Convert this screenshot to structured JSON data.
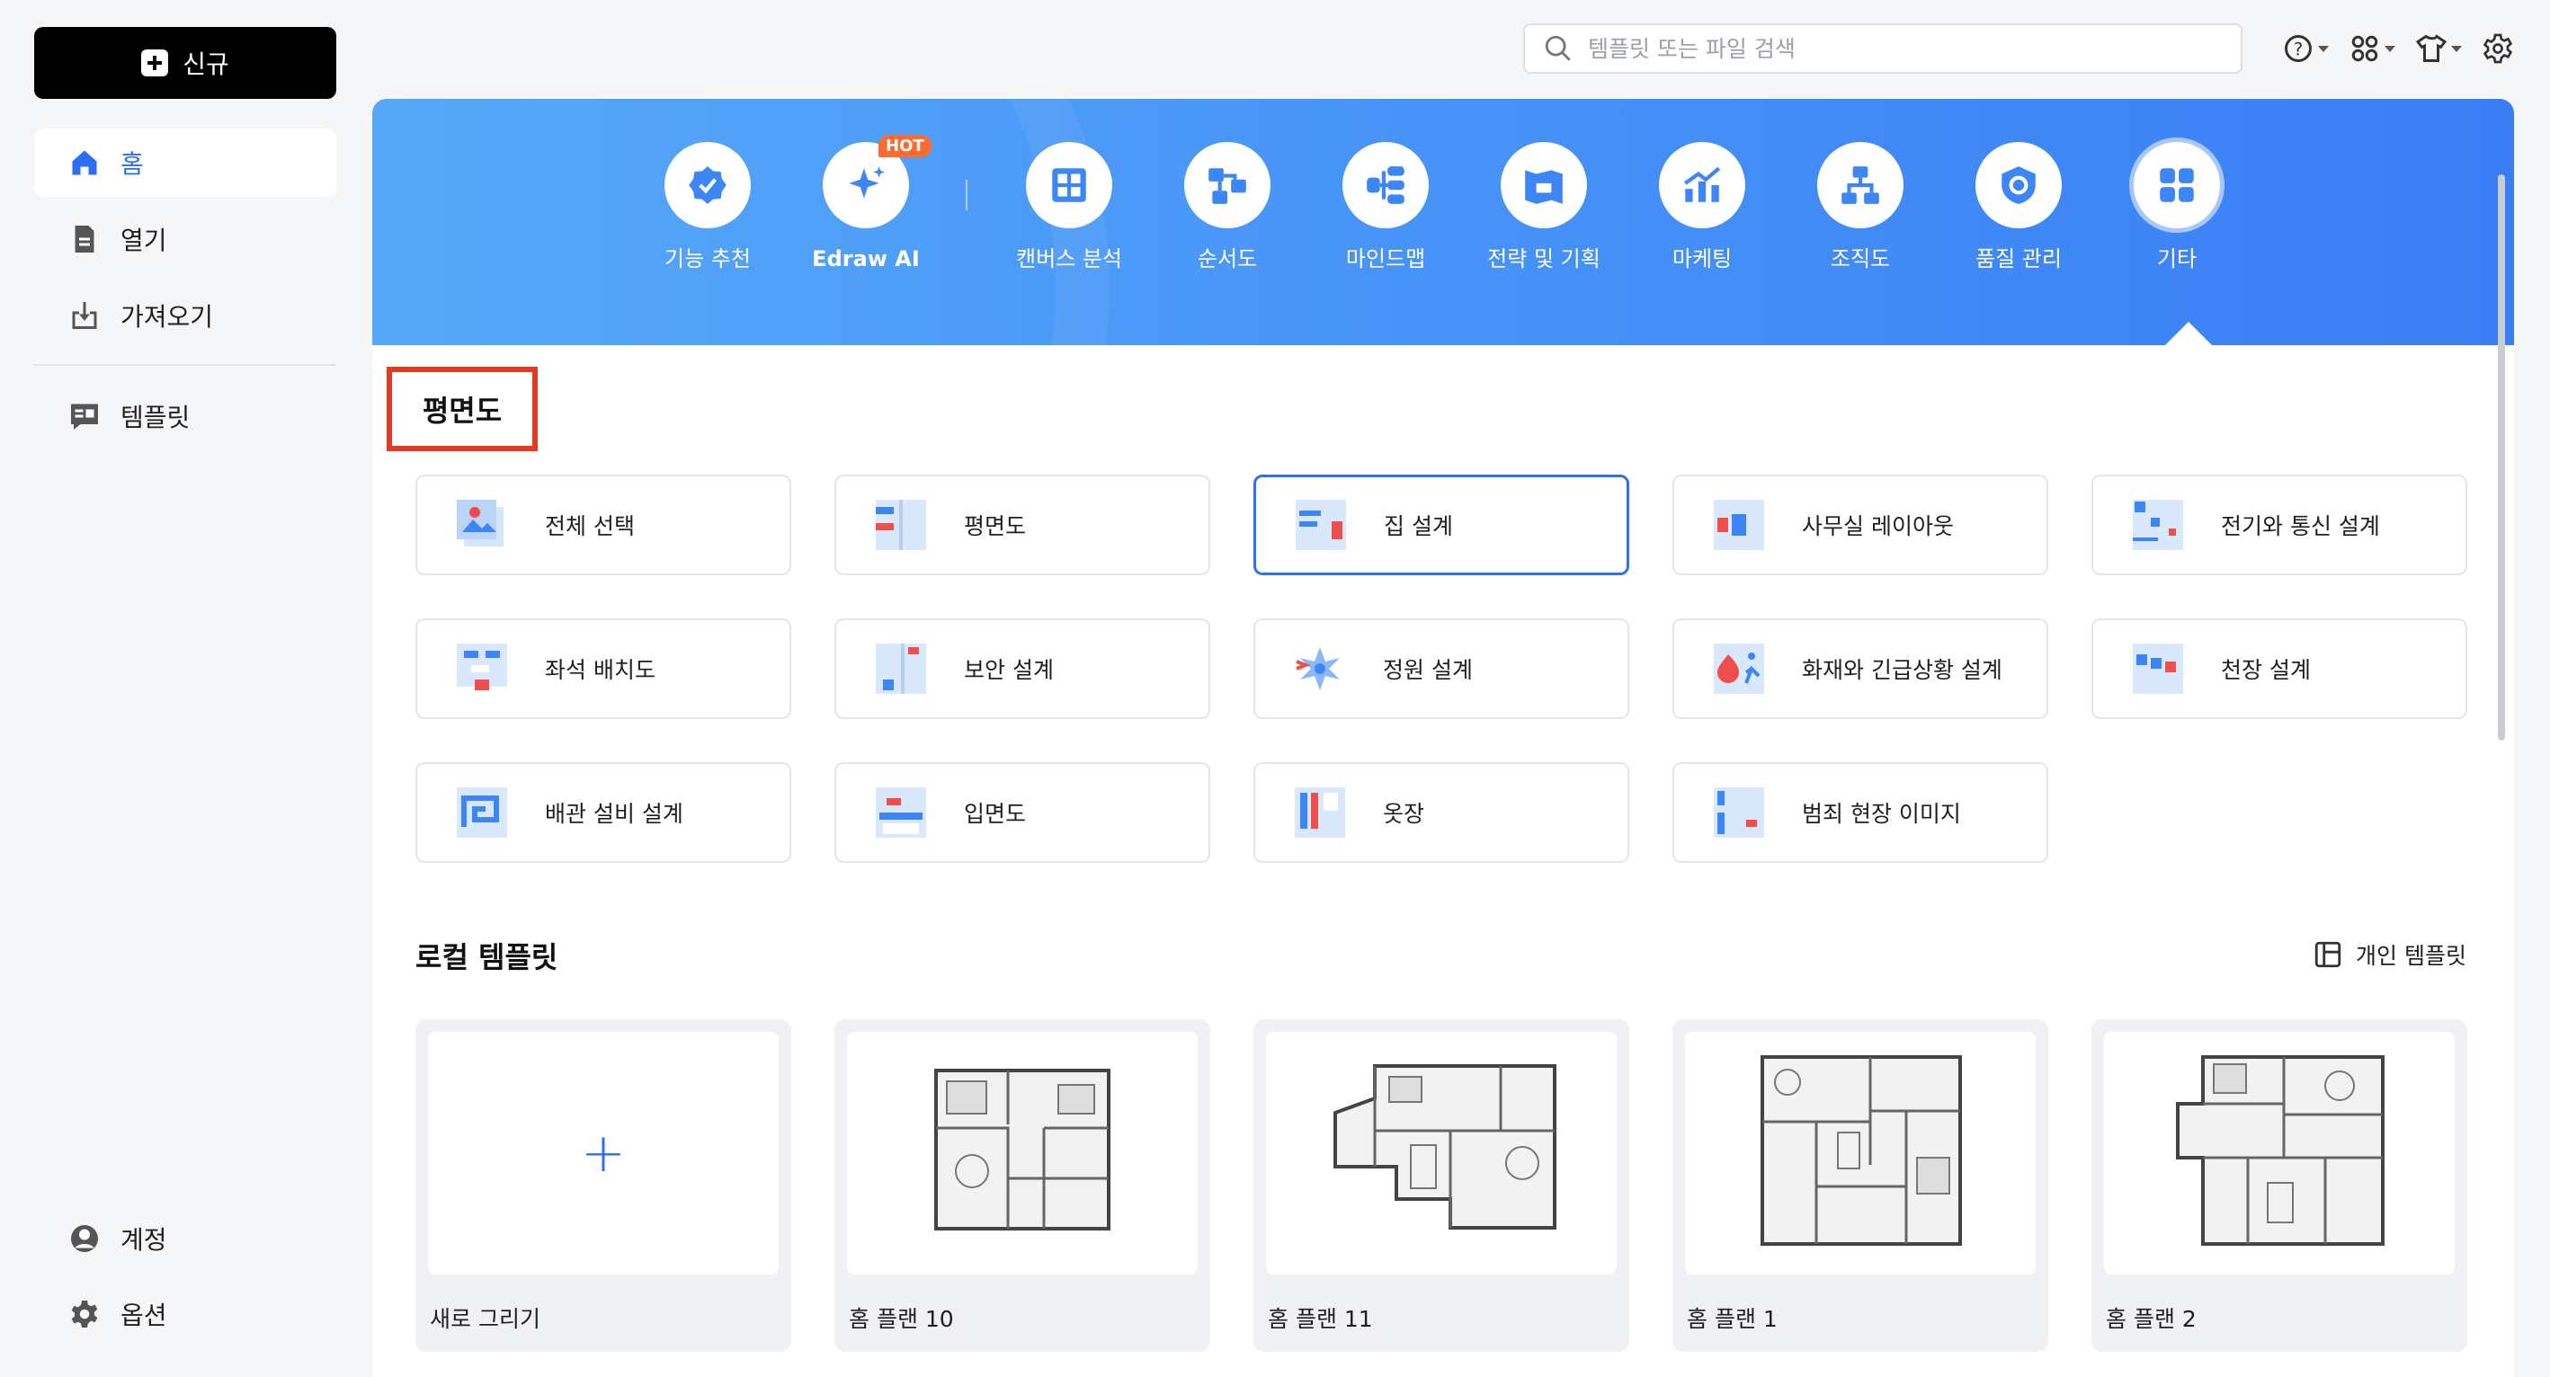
{
  "sidebar": {
    "new_label": "신규",
    "nav": [
      {
        "label": "홈",
        "icon": "home-icon",
        "active": true
      },
      {
        "label": "열기",
        "icon": "file-icon"
      },
      {
        "label": "가져오기",
        "icon": "import-icon"
      },
      {
        "label": "템플릿",
        "icon": "template-icon"
      }
    ],
    "bottom": [
      {
        "label": "계정",
        "icon": "account-icon"
      },
      {
        "label": "옵션",
        "icon": "gear-icon"
      }
    ]
  },
  "topbar": {
    "search_placeholder": "템플릿 또는 파일 검색",
    "icons": [
      "help-icon",
      "apps-icon",
      "theme-icon",
      "settings-icon"
    ]
  },
  "banner": {
    "categories": [
      {
        "label": "기능 추천",
        "icon": "recommend-icon"
      },
      {
        "label": "Edraw AI",
        "icon": "ai-sparkle-icon",
        "badge": "HOT"
      },
      {
        "label": "캔버스 분석",
        "icon": "canvas-icon"
      },
      {
        "label": "순서도",
        "icon": "flowchart-icon"
      },
      {
        "label": "마인드맵",
        "icon": "mindmap-icon"
      },
      {
        "label": "전략 및 기획",
        "icon": "strategy-icon"
      },
      {
        "label": "마케팅",
        "icon": "marketing-icon"
      },
      {
        "label": "조직도",
        "icon": "orgchart-icon"
      },
      {
        "label": "품질 관리",
        "icon": "quality-icon"
      },
      {
        "label": "기타",
        "icon": "grid-icon",
        "selected": true
      }
    ]
  },
  "section_title": "평면도",
  "templates": [
    {
      "label": "전체 선택"
    },
    {
      "label": "평면도"
    },
    {
      "label": "집 설계",
      "selected": true
    },
    {
      "label": "사무실 레이아웃"
    },
    {
      "label": "전기와 통신 설계"
    },
    {
      "label": "좌석 배치도"
    },
    {
      "label": "보안 설계"
    },
    {
      "label": "정원 설계"
    },
    {
      "label": "화재와 긴급상황 설계"
    },
    {
      "label": "천장 설계"
    },
    {
      "label": "배관 설비 설계"
    },
    {
      "label": "입면도"
    },
    {
      "label": "옷장"
    },
    {
      "label": "범죄 현장 이미지"
    }
  ],
  "local": {
    "title": "로컬 템플릿",
    "personal_label": "개인 템플릿",
    "cards": [
      {
        "label": "새로 그리기"
      },
      {
        "label": "홈 플랜 10"
      },
      {
        "label": "홈 플랜 11"
      },
      {
        "label": "홈 플랜 1"
      },
      {
        "label": "홈 플랜 2"
      }
    ]
  },
  "colors": {
    "accent": "#2d6cf4",
    "banner": "#4895f8",
    "highlight": "#e2391f"
  }
}
